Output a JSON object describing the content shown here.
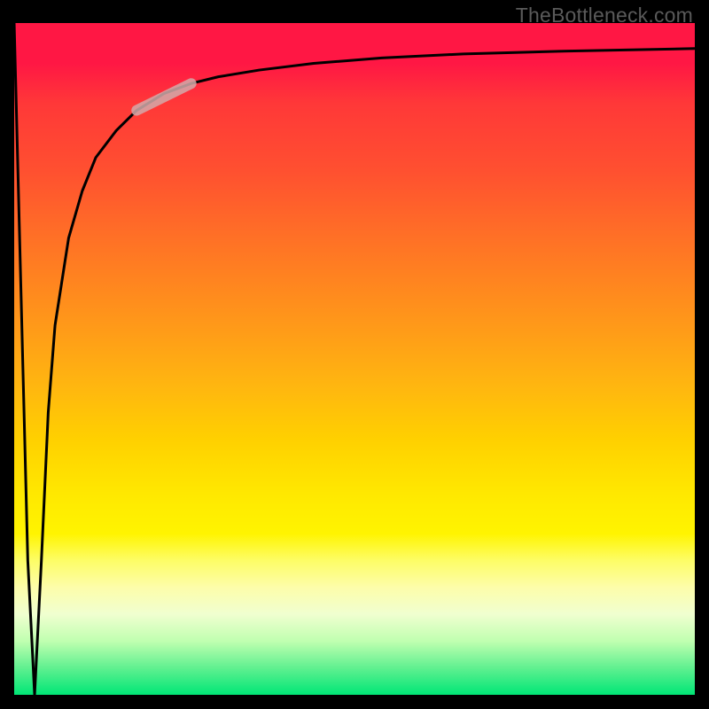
{
  "watermark": "TheBottleneck.com",
  "chart_data": {
    "type": "line",
    "title": "",
    "xlabel": "",
    "ylabel": "",
    "xrange": [
      0,
      100
    ],
    "yrange": [
      0,
      100
    ],
    "annotations": [],
    "series": [
      {
        "name": "bottleneck-curve",
        "x": [
          0,
          1,
          2,
          3,
          4,
          5,
          6,
          8,
          10,
          12,
          15,
          18,
          22,
          26,
          30,
          36,
          44,
          54,
          66,
          80,
          100
        ],
        "y": [
          100,
          60,
          20,
          0,
          20,
          42,
          55,
          68,
          75,
          80,
          84,
          87,
          89.5,
          91,
          92,
          93,
          94,
          94.8,
          95.4,
          95.8,
          96.2
        ],
        "stroke": "#000000"
      },
      {
        "name": "highlight-segment",
        "x": [
          18,
          26
        ],
        "y": [
          87,
          91
        ],
        "stroke": "rgba(210,170,170,0.85)"
      }
    ]
  }
}
